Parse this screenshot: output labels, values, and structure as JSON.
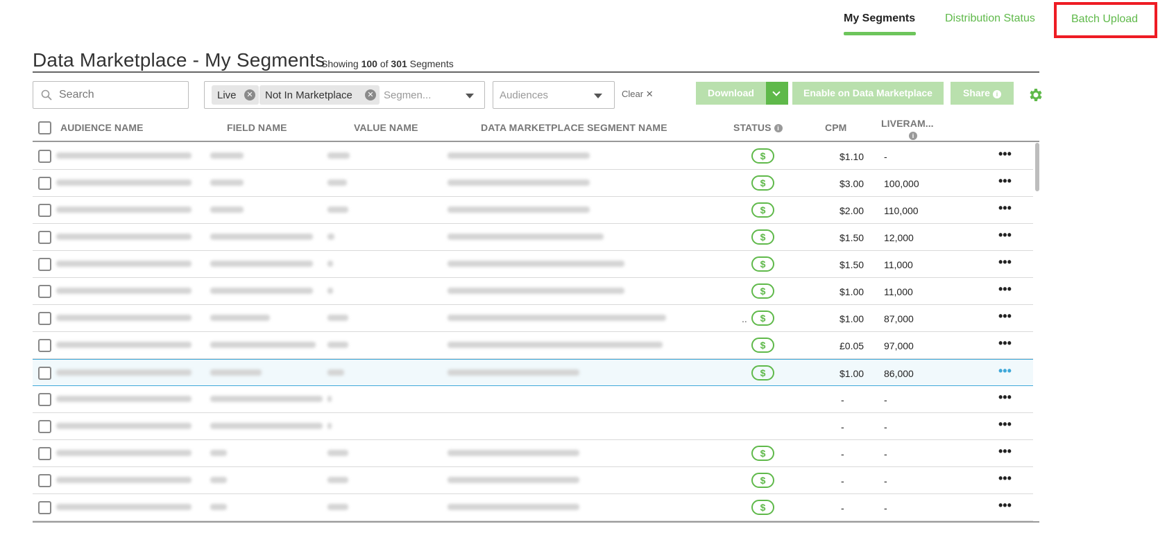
{
  "nav": {
    "my_segments": "My Segments",
    "distribution_status": "Distribution Status",
    "batch_upload": "Batch Upload"
  },
  "page": {
    "title": "Data Marketplace - My Segments",
    "showing_prefix": "Showing",
    "showing_count": "100",
    "showing_of": "of",
    "showing_total": "301",
    "showing_suffix": "Segments"
  },
  "toolbar": {
    "search_placeholder": "Search",
    "segment_chips": [
      "Live",
      "Not In Marketplace"
    ],
    "segment_placeholder": "Segmen...",
    "audiences_placeholder": "Audiences",
    "clear_label": "Clear",
    "download_label": "Download",
    "enable_label": "Enable on Data Marketplace",
    "share_label": "Share",
    "accent_color": "#5fb94a",
    "disabled_color": "#b9e0ad"
  },
  "table": {
    "columns": {
      "audience_name": "AUDIENCE NAME",
      "field_name": "FIELD NAME",
      "value_name": "VALUE NAME",
      "dm_segment_name": "DATA MARKETPLACE SEGMENT NAME",
      "status": "STATUS",
      "cpm": "CPM",
      "liveramp": "LIVERAM..."
    },
    "status_symbol": "$",
    "more_symbol": "•••",
    "rows": [
      {
        "status": true,
        "cpm": "$1.10",
        "lr": "-"
      },
      {
        "status": true,
        "cpm": "$3.00",
        "lr": "100,000"
      },
      {
        "status": true,
        "cpm": "$2.00",
        "lr": "110,000"
      },
      {
        "status": true,
        "cpm": "$1.50",
        "lr": "12,000"
      },
      {
        "status": true,
        "cpm": "$1.50",
        "lr": "11,000"
      },
      {
        "status": true,
        "cpm": "$1.00",
        "lr": "11,000"
      },
      {
        "status": true,
        "cpm": "$1.00",
        "lr": "87,000",
        "truncated": ".."
      },
      {
        "status": true,
        "cpm": "£0.05",
        "lr": "97,000"
      },
      {
        "status": true,
        "cpm": "$1.00",
        "lr": "86,000",
        "selected": true
      },
      {
        "status": false,
        "cpm": "-",
        "lr": "-"
      },
      {
        "status": false,
        "cpm": "-",
        "lr": "-"
      },
      {
        "status": true,
        "cpm": "-",
        "lr": "-"
      },
      {
        "status": true,
        "cpm": "-",
        "lr": "-"
      },
      {
        "status": true,
        "cpm": "-",
        "lr": "-"
      }
    ]
  }
}
